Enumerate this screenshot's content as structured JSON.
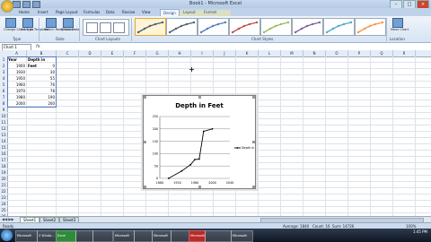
{
  "window": {
    "title": "Book1 - Microsoft Excel"
  },
  "ribbon": {
    "tabs": [
      "Home",
      "Insert",
      "Page Layout",
      "Formulas",
      "Data",
      "Review",
      "View",
      "Design",
      "Layout",
      "Format"
    ],
    "active_tab": "Design",
    "buttons": [
      {
        "label": "Change Chart Type"
      },
      {
        "label": "Save As Template"
      },
      {
        "label": "Switch Row/Column"
      },
      {
        "label": "Select Data"
      },
      {
        "label": "Move Chart"
      }
    ],
    "groups": [
      "Type",
      "Data",
      "Chart Layouts",
      "Chart Styles",
      "Location"
    ]
  },
  "formula_bar": {
    "name_box": "Chart 1",
    "fx": "fx"
  },
  "sheet": {
    "columns": [
      "A",
      "B",
      "C",
      "D",
      "E",
      "F",
      "G",
      "H",
      "I",
      "J",
      "K",
      "L",
      "M",
      "N",
      "O",
      "P",
      "Q",
      "R"
    ],
    "rows": [
      "1",
      "2",
      "3",
      "4",
      "5",
      "6",
      "7",
      "8",
      "9",
      "10",
      "11",
      "12",
      "13",
      "14",
      "15",
      "16",
      "17",
      "18",
      "19",
      "20",
      "21",
      "22",
      "23",
      "24",
      "25",
      "26"
    ],
    "headers": [
      "Year",
      "Depth in Feet"
    ],
    "data": [
      [
        "1900",
        "0"
      ],
      [
        "1930",
        "30"
      ],
      [
        "1950",
        "55"
      ],
      [
        "1960",
        "76"
      ],
      [
        "1970",
        "78"
      ],
      [
        "1980",
        "190"
      ],
      [
        "2000",
        "200"
      ]
    ],
    "tabs": [
      "Sheet1",
      "Sheet2",
      "Sheet3"
    ]
  },
  "chart_data": {
    "type": "line",
    "title": "Depth in Feet",
    "x": [
      1900,
      1930,
      1950,
      1960,
      1970,
      1980,
      2000
    ],
    "series": [
      {
        "name": "Depth in Feet",
        "values": [
          0,
          30,
          55,
          76,
          78,
          190,
          200
        ],
        "color": "#000000"
      }
    ],
    "xlim": [
      1880,
      2040
    ],
    "ylim": [
      0,
      250
    ],
    "xticks": [
      "1880",
      "1900",
      "1920",
      "1940",
      "1960",
      "1980",
      "2000",
      "2020",
      "2040"
    ],
    "yticks": [
      "0",
      "50",
      "100",
      "150",
      "200",
      "250"
    ],
    "grid": true,
    "legend": "right"
  },
  "status_bar": {
    "ready": "Ready",
    "average": "Average: 1840",
    "count": "Count: 16",
    "sum": "Sum: 14726",
    "zoom": "100%"
  },
  "taskbar": {
    "items": [
      "Microsoft",
      "2 Windo...",
      "Excel",
      "",
      "",
      "Microsoft",
      "",
      "Microsoft",
      "",
      "Microsoft",
      "",
      "Microsoft"
    ],
    "time": "1:45 PM"
  }
}
